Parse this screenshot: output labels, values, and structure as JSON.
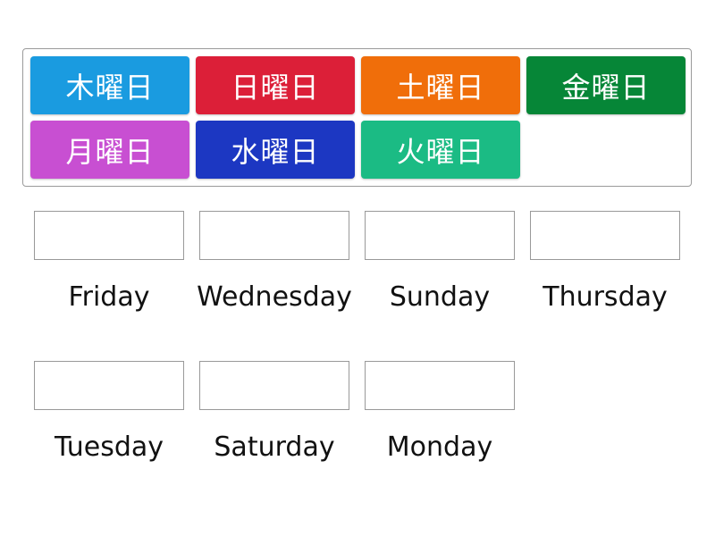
{
  "tiles": [
    {
      "label": "木曜日",
      "color": "#1a9be0"
    },
    {
      "label": "日曜日",
      "color": "#dc1f38"
    },
    {
      "label": "土曜日",
      "color": "#f06e0a"
    },
    {
      "label": "金曜日",
      "color": "#068637"
    },
    {
      "label": "月曜日",
      "color": "#c84fd2"
    },
    {
      "label": "水曜日",
      "color": "#1c37c2"
    },
    {
      "label": "火曜日",
      "color": "#1bbb84"
    }
  ],
  "targets": [
    {
      "label": "Friday"
    },
    {
      "label": "Wednesday"
    },
    {
      "label": "Sunday"
    },
    {
      "label": "Thursday"
    },
    {
      "label": "Tuesday"
    },
    {
      "label": "Saturday"
    },
    {
      "label": "Monday"
    }
  ]
}
